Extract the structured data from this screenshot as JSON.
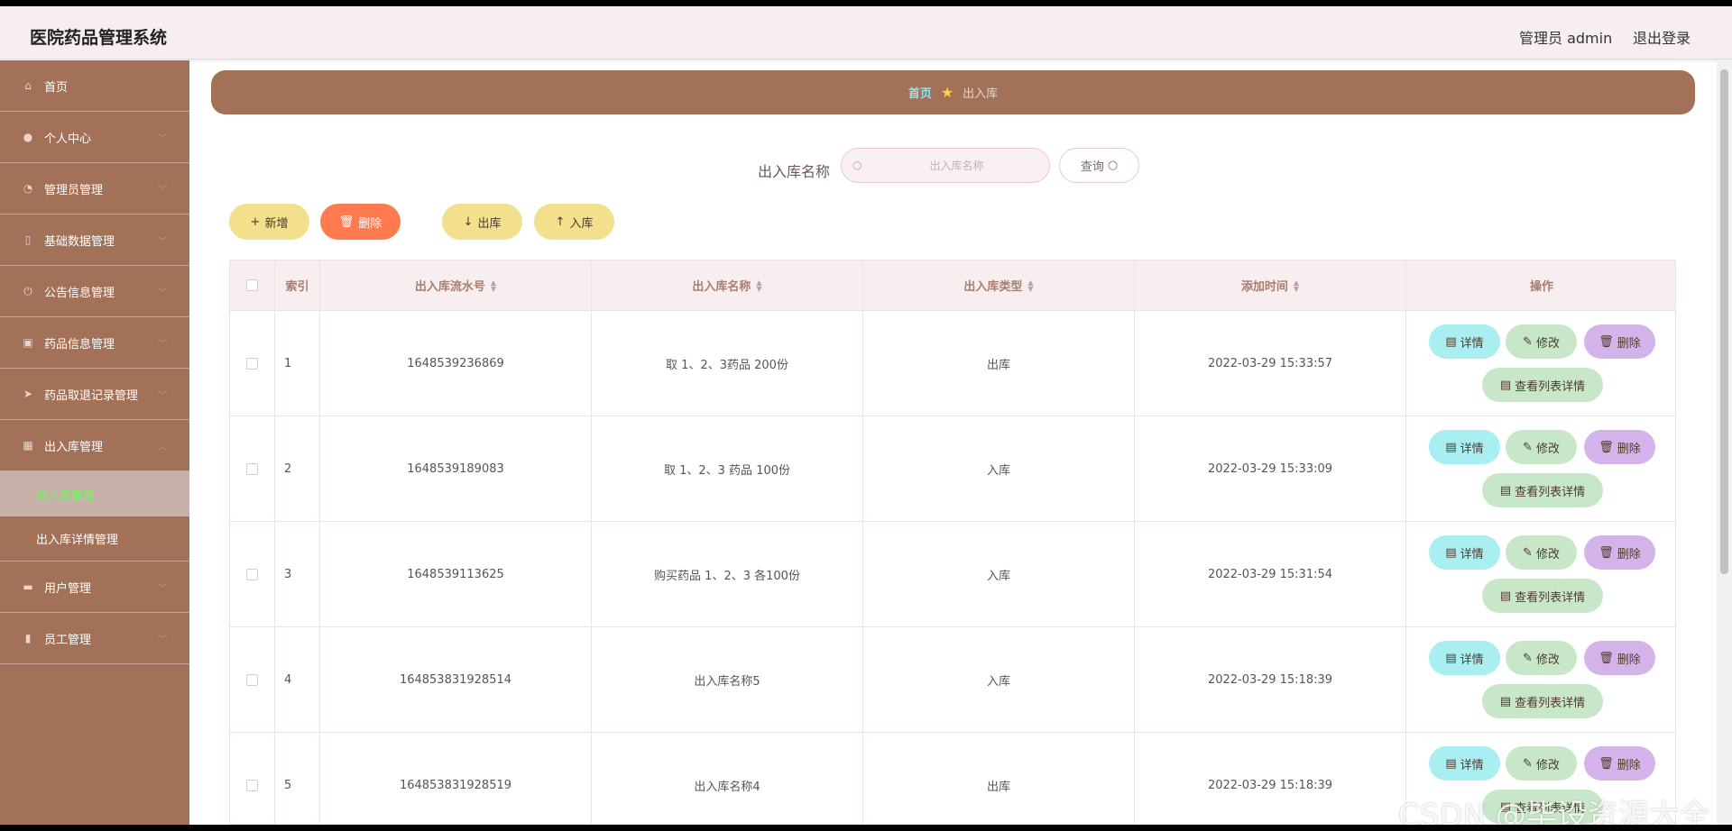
{
  "header": {
    "app_title": "医院药品管理系统",
    "user_label": "管理员 admin",
    "logout": "退出登录"
  },
  "sidebar": {
    "items": [
      {
        "label": "首页",
        "icon": "home-icon",
        "has_chevron": false
      },
      {
        "label": "个人中心",
        "icon": "user-icon",
        "has_chevron": true
      },
      {
        "label": "管理员管理",
        "icon": "gauge-icon",
        "has_chevron": true
      },
      {
        "label": "基础数据管理",
        "icon": "phone-icon",
        "has_chevron": true
      },
      {
        "label": "公告信息管理",
        "icon": "power-icon",
        "has_chevron": true
      },
      {
        "label": "药品信息管理",
        "icon": "image-icon",
        "has_chevron": true
      },
      {
        "label": "药品取退记录管理",
        "icon": "send-icon",
        "has_chevron": true
      },
      {
        "label": "出入库管理",
        "icon": "grid-icon",
        "has_chevron": true
      }
    ],
    "sub_items": [
      {
        "label": "出入库管理",
        "active": true
      },
      {
        "label": "出入库详情管理",
        "active": false
      }
    ],
    "more_items": [
      {
        "label": "用户管理",
        "icon": "bank-icon"
      },
      {
        "label": "员工管理",
        "icon": "bar-chart-icon"
      }
    ],
    "active_sub_color": "#7cf06a"
  },
  "breadcrumb": {
    "home": "首页",
    "current": "出入库"
  },
  "search": {
    "label": "出入库名称",
    "placeholder": "出入库名称",
    "button": "查询"
  },
  "toolbar": {
    "add": "新增",
    "delete": "删除",
    "out": "出库",
    "in": "入库"
  },
  "table": {
    "headers": {
      "index": "索引",
      "serial": "出入库流水号",
      "name": "出入库名称",
      "type": "出入库类型",
      "time": "添加时间",
      "ops": "操作"
    },
    "rows": [
      {
        "index": "1",
        "serial": "1648539236869",
        "name": "取 1、2、3药品 200份",
        "type": "出库",
        "time": "2022-03-29 15:33:57"
      },
      {
        "index": "2",
        "serial": "1648539189083",
        "name": "取 1、2、3 药品 100份",
        "type": "入库",
        "time": "2022-03-29 15:33:09"
      },
      {
        "index": "3",
        "serial": "1648539113625",
        "name": "购买药品 1、2、3 各100份",
        "type": "入库",
        "time": "2022-03-29 15:31:54"
      },
      {
        "index": "4",
        "serial": "164853831928514",
        "name": "出入库名称5",
        "type": "入库",
        "time": "2022-03-29 15:18:39"
      },
      {
        "index": "5",
        "serial": "164853831928519",
        "name": "出入库名称4",
        "type": "出库",
        "time": "2022-03-29 15:18:39"
      }
    ],
    "actions": {
      "detail": "详情",
      "edit": "修改",
      "delete": "删除",
      "list_detail": "查看列表详情"
    }
  },
  "watermark": "CSDN @毕设资源大全",
  "colors": {
    "sidebar": "#a37058",
    "header": "#f7eef0",
    "detail_btn": "#a9eef0",
    "edit_btn": "#c8e7c9",
    "delete_btn": "#d4b3ea",
    "toolbar_yellow": "#f2e08c",
    "toolbar_red": "#ff7a4f"
  }
}
